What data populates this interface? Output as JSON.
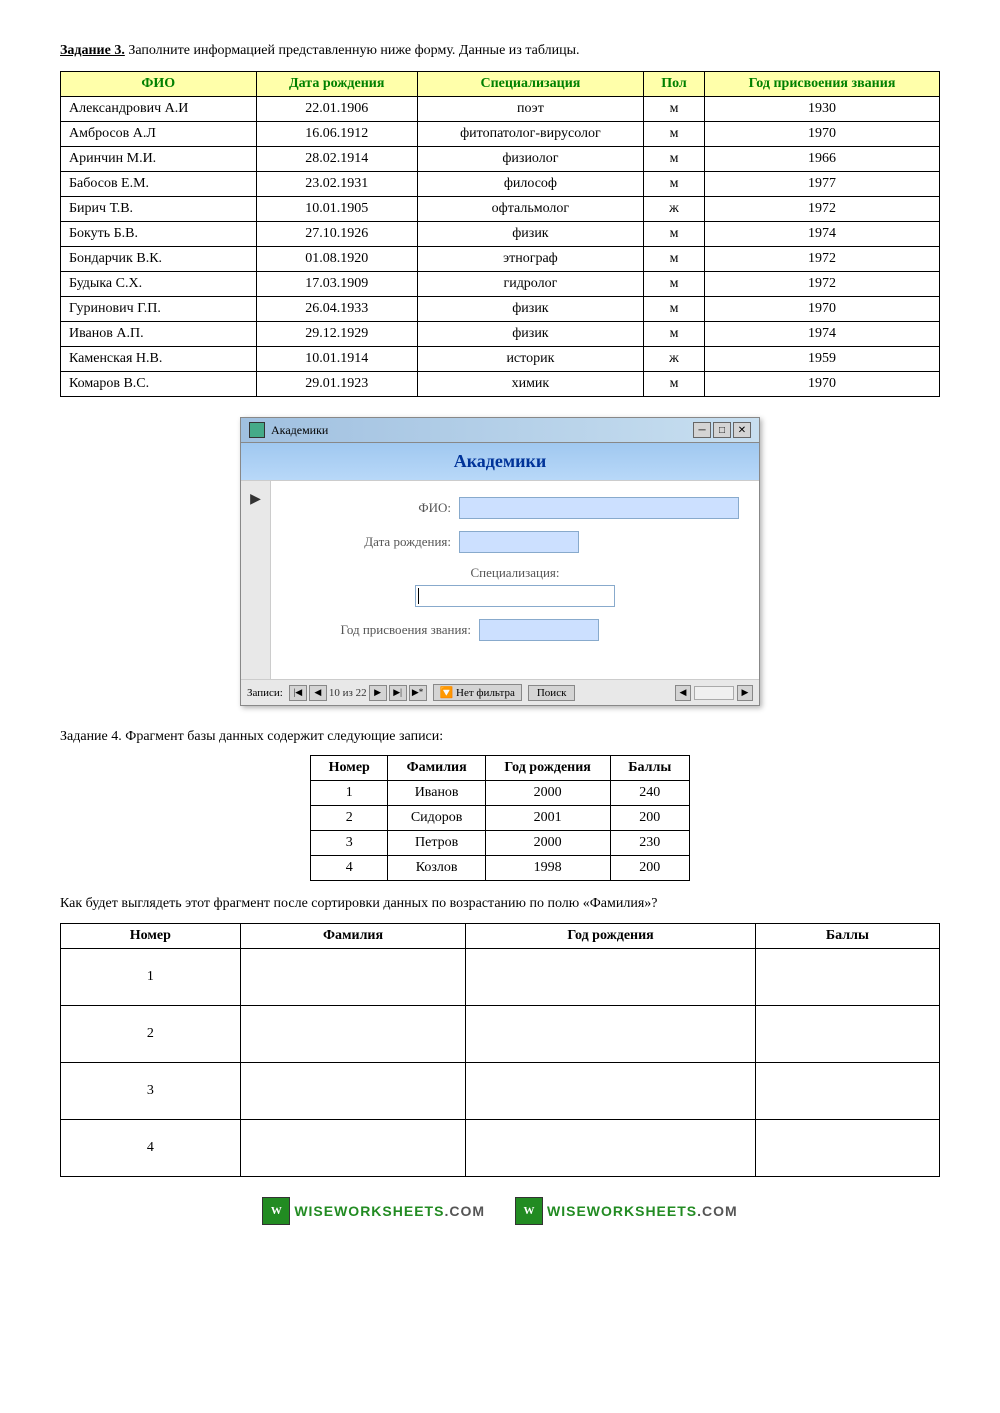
{
  "task3": {
    "heading_num": "Задание 3.",
    "heading_text": " Заполните информацией представленную ниже форму. Данные из таблицы.",
    "table": {
      "headers": [
        "ФИО",
        "Дата рождения",
        "Специализация",
        "Пол",
        "Год присвоения звания"
      ],
      "rows": [
        [
          "Александрович А.И",
          "22.01.1906",
          "поэт",
          "м",
          "1930"
        ],
        [
          "Амбросов А.Л",
          "16.06.1912",
          "фитопатолог-вирусолог",
          "м",
          "1970"
        ],
        [
          "Аринчин М.И.",
          "28.02.1914",
          "физиолог",
          "м",
          "1966"
        ],
        [
          "Бабосов Е.М.",
          "23.02.1931",
          "философ",
          "м",
          "1977"
        ],
        [
          "Бирич Т.В.",
          "10.01.1905",
          "офтальмолог",
          "ж",
          "1972"
        ],
        [
          "Бокуть Б.В.",
          "27.10.1926",
          "физик",
          "м",
          "1974"
        ],
        [
          "Бондарчик В.К.",
          "01.08.1920",
          "этнограф",
          "м",
          "1972"
        ],
        [
          "Будыка С.Х.",
          "17.03.1909",
          "гидролог",
          "м",
          "1972"
        ],
        [
          "Гуринович Г.П.",
          "26.04.1933",
          "физик",
          "м",
          "1970"
        ],
        [
          "Иванов А.П.",
          "29.12.1929",
          "физик",
          "м",
          "1974"
        ],
        [
          "Каменская Н.В.",
          "10.01.1914",
          "историк",
          "ж",
          "1959"
        ],
        [
          "Комаров В.С.",
          "29.01.1923",
          "химик",
          "м",
          "1970"
        ]
      ]
    }
  },
  "access_window": {
    "title_text": "Академики",
    "form_title": "Академики",
    "fields": {
      "fio_label": "ФИО:",
      "dob_label": "Дата рождения:",
      "spec_label": "Специализация:",
      "year_label": "Год присвоения звания:"
    },
    "statusbar": {
      "records_text": "Записи: ",
      "nav_info": "10 из 22",
      "filter_text": "Нет фильтра",
      "search_text": "Поиск"
    }
  },
  "task4": {
    "heading_num": "Задание 4.",
    "heading_text": " Фрагмент базы данных содержит следующие записи:",
    "table": {
      "headers": [
        "Номер",
        "Фамилия",
        "Год рождения",
        "Баллы"
      ],
      "rows": [
        [
          "1",
          "Иванов",
          "2000",
          "240"
        ],
        [
          "2",
          "Сидоров",
          "2001",
          "200"
        ],
        [
          "3",
          "Петров",
          "2000",
          "230"
        ],
        [
          "4",
          "Козлов",
          "1998",
          "200"
        ]
      ]
    },
    "question_text": "Как  будет выглядеть этот фрагмент после сортировки данных по возрастанию по полю «Фамилия»?",
    "answer_table": {
      "headers": [
        "Номер",
        "Фамилия",
        "Год рождения",
        "Баллы"
      ],
      "rows": [
        [
          "1",
          "",
          "",
          ""
        ],
        [
          "2",
          "",
          "",
          ""
        ],
        [
          "3",
          "",
          "",
          ""
        ],
        [
          "4",
          "",
          "",
          ""
        ]
      ]
    }
  },
  "footer": {
    "logo1_icon": "W",
    "logo1_text": "WISEWORKSHEETS.COM",
    "logo2_icon": "W",
    "logo2_text": "WISEWORKSHEETS.COM"
  }
}
